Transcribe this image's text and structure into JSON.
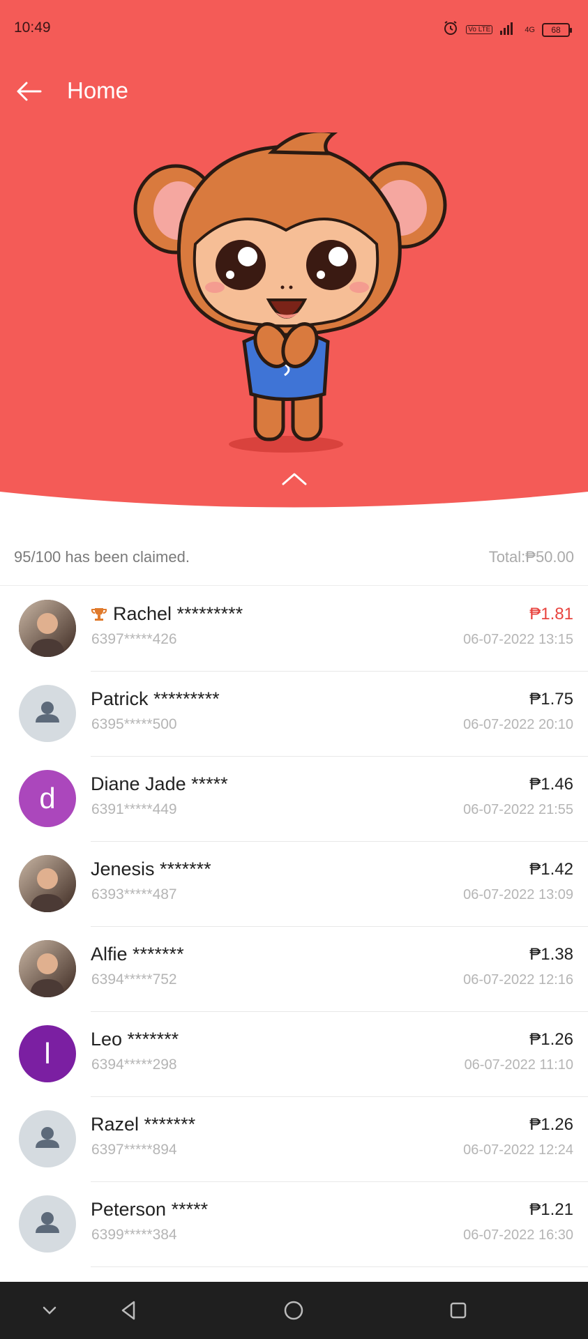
{
  "status_bar": {
    "time": "10:49",
    "lte_label": "Vo LTE",
    "network_label": "4G",
    "battery": "68"
  },
  "header": {
    "title": "Home",
    "back_icon": "arrow-left-icon"
  },
  "colors": {
    "hero_bg": "#f45b57",
    "highlight_amount": "#e8443f"
  },
  "summary": {
    "claimed": "95/100 has been claimed.",
    "total": "Total:₱50.00"
  },
  "claims": [
    {
      "name": "Rachel *********",
      "phone": "6397*****426",
      "amount": "₱1.81",
      "date": "06-07-2022 13:15",
      "avatar_type": "photo",
      "avatar_color": "#5a3a2e",
      "best": true
    },
    {
      "name": "Patrick *********",
      "phone": "6395*****500",
      "amount": "₱1.75",
      "date": "06-07-2022 20:10",
      "avatar_type": "default",
      "avatar_color": "#d5dbe0",
      "best": false
    },
    {
      "name": "Diane Jade *****",
      "phone": "6391*****449",
      "amount": "₱1.46",
      "date": "06-07-2022 21:55",
      "avatar_type": "letter",
      "avatar_letter": "d",
      "avatar_color": "#ab47bc",
      "best": false
    },
    {
      "name": "Jenesis *******",
      "phone": "6393*****487",
      "amount": "₱1.42",
      "date": "06-07-2022 13:09",
      "avatar_type": "photo",
      "avatar_color": "#8a7060",
      "best": false
    },
    {
      "name": "Alfie *******",
      "phone": "6394*****752",
      "amount": "₱1.38",
      "date": "06-07-2022 12:16",
      "avatar_type": "photo",
      "avatar_color": "#6b4a3a",
      "best": false
    },
    {
      "name": "Leo *******",
      "phone": "6394*****298",
      "amount": "₱1.26",
      "date": "06-07-2022 11:10",
      "avatar_type": "letter",
      "avatar_letter": "l",
      "avatar_color": "#7b1fa2",
      "best": false
    },
    {
      "name": "Razel *******",
      "phone": "6397*****894",
      "amount": "₱1.26",
      "date": "06-07-2022 12:24",
      "avatar_type": "default",
      "avatar_color": "#d5dbe0",
      "best": false
    },
    {
      "name": "Peterson *****",
      "phone": "6399*****384",
      "amount": "₱1.21",
      "date": "06-07-2022 16:30",
      "avatar_type": "default",
      "avatar_color": "#d5dbe0",
      "best": false
    }
  ],
  "nav_bar": {
    "icons": [
      "chevron-down-icon",
      "back-triangle-icon",
      "home-circle-icon",
      "recents-square-icon"
    ]
  }
}
